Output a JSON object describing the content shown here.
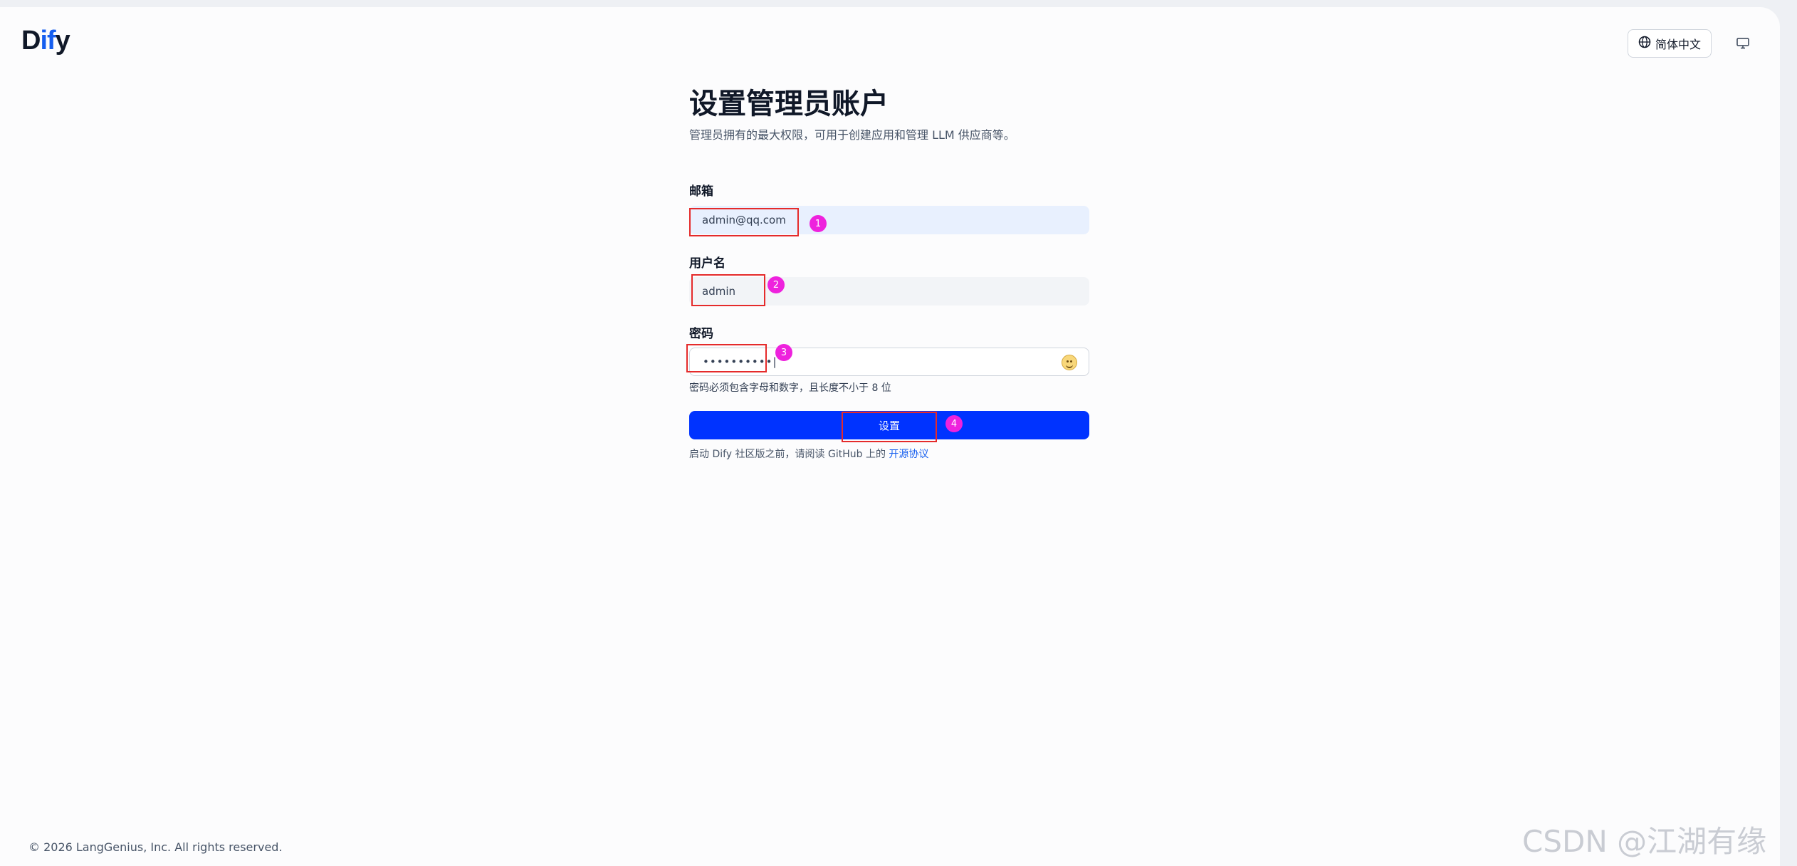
{
  "app": {
    "logo_text_d": "D",
    "logo_text_if": "if",
    "logo_text_y": "y"
  },
  "header": {
    "language_label": "简体中文"
  },
  "main": {
    "title": "设置管理员账户",
    "subtitle": "管理员拥有的最大权限，可用于创建应用和管理 LLM 供应商等。"
  },
  "form": {
    "email_label": "邮箱",
    "email_value": "admin@qq.com",
    "username_label": "用户名",
    "username_value": "admin",
    "password_label": "密码",
    "password_value": "••••••••••|",
    "password_hint": "密码必须包含字母和数字，且长度不小于 8 位",
    "submit_label": "设置",
    "license_text": "启动 Dify 社区版之前，请阅读 GitHub 上的 ",
    "license_link": "开源协议"
  },
  "annotations": {
    "badge1": "1",
    "badge2": "2",
    "badge3": "3",
    "badge4": "4"
  },
  "footer": {
    "copyright": "© 2026 LangGenius, Inc. All rights reserved."
  },
  "watermark": {
    "text": "CSDN @江湖有缘"
  },
  "colors": {
    "primary": "#0033ff",
    "annotation_box": "#e52b2b",
    "annotation_badge": "#ee22dd"
  }
}
